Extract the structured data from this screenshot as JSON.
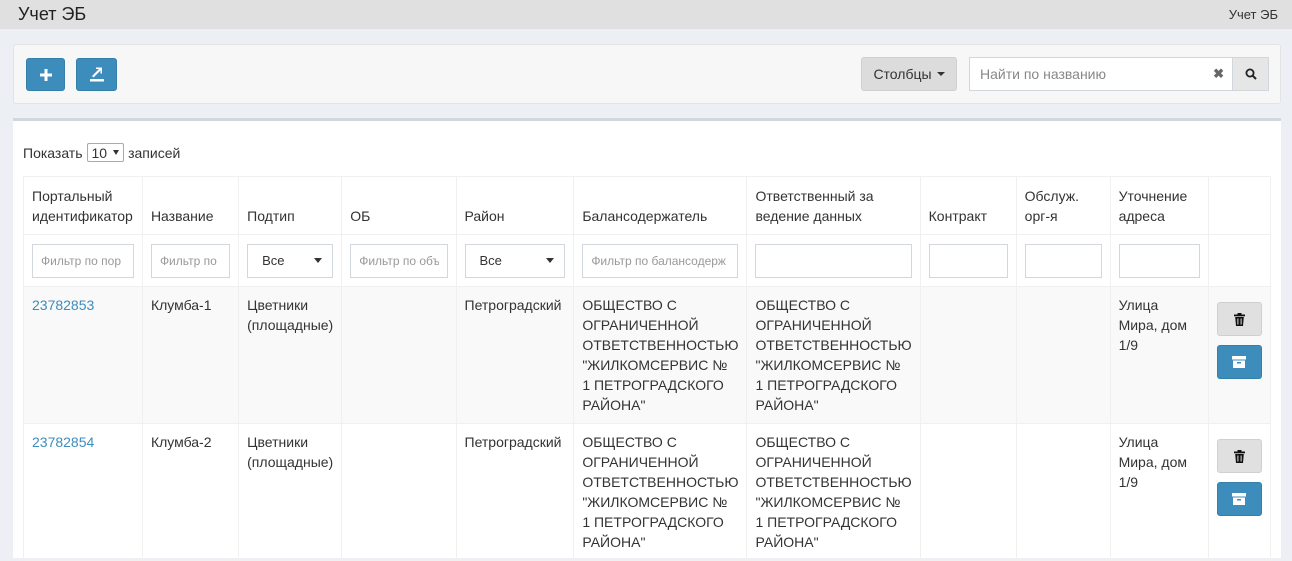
{
  "header": {
    "title": "Учет ЭБ",
    "breadcrumb": "Учет ЭБ"
  },
  "toolbar": {
    "add_icon": "plus-icon",
    "export_icon": "export-icon",
    "columns_label": "Столбцы",
    "search_placeholder": "Найти по названию",
    "clear_icon": "close-icon",
    "search_icon": "search-icon"
  },
  "table": {
    "show_label": "Показать",
    "page_length": "10",
    "entries_label": "записей",
    "columns": [
      "Портальный идентификатор",
      "Название",
      "Подтип",
      "ОБ",
      "Район",
      "Балансодержатель",
      "Ответственный за ведение данных",
      "Контракт",
      "Обслуж. орг-я",
      "Уточнение адреса"
    ],
    "filters": {
      "portal_id_placeholder": "Фильтр по пор",
      "name_placeholder": "Фильтр по",
      "subtype_value": "Все",
      "ob_placeholder": "Фильтр по объ",
      "district_value": "Все",
      "holder_placeholder": "Фильтр по балансодерж"
    },
    "rows": [
      {
        "id": "23782853",
        "name": "Клумба-1",
        "subtype": "Цветники (площадные)",
        "ob": "",
        "district": "Петроградский",
        "holder": "ОБЩЕСТВО С ОГРАНИЧЕННОЙ ОТВЕТСТВЕННОСТЬЮ \"ЖИЛКОМСЕРВИС № 1 ПЕТРОГРАДСКОГО РАЙОНА\"",
        "responsible": "ОБЩЕСТВО С ОГРАНИЧЕННОЙ ОТВЕТСТВЕННОСТЬЮ \"ЖИЛКОМСЕРВИС № 1 ПЕТРОГРАДСКОГО РАЙОНА\"",
        "contract": "",
        "service_org": "",
        "address": "Улица Мира, дом 1/9"
      },
      {
        "id": "23782854",
        "name": "Клумба-2",
        "subtype": "Цветники (площадные)",
        "ob": "",
        "district": "Петроградский",
        "holder": "ОБЩЕСТВО С ОГРАНИЧЕННОЙ ОТВЕТСТВЕННОСТЬЮ \"ЖИЛКОМСЕРВИС № 1 ПЕТРОГРАДСКОГО РАЙОНА\"",
        "responsible": "ОБЩЕСТВО С ОГРАНИЧЕННОЙ ОТВЕТСТВЕННОСТЬЮ \"ЖИЛКОМСЕРВИС № 1 ПЕТРОГРАДСКОГО РАЙОНА\"",
        "contract": "",
        "service_org": "",
        "address": "Улица Мира, дом 1/9"
      }
    ],
    "row_action_icons": [
      "trash-icon",
      "archive-icon"
    ]
  },
  "colors": {
    "primary": "#3c8dbc",
    "link": "#3c8dbc",
    "topbar": "#e0e0e0",
    "background": "#ecf0f5"
  }
}
